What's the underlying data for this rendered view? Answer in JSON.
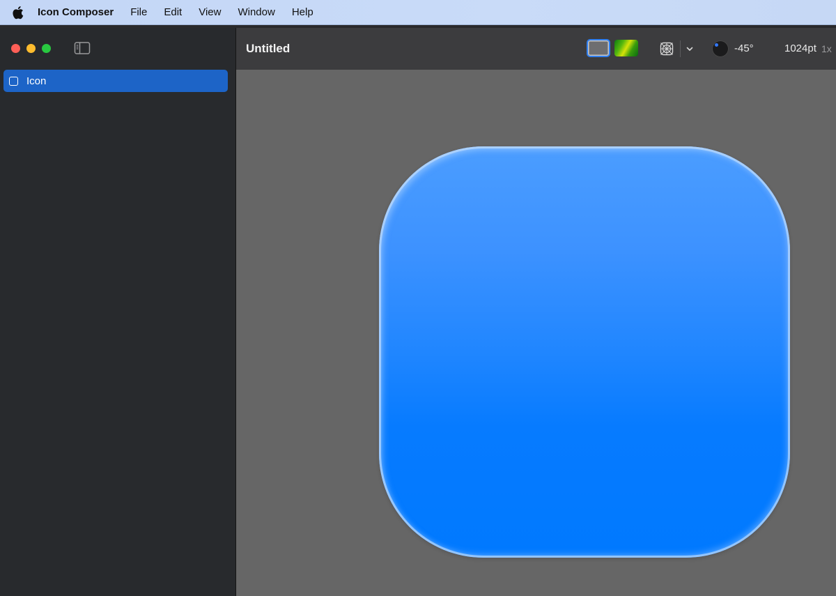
{
  "menubar": {
    "app_name": "Icon Composer",
    "items": [
      "File",
      "Edit",
      "View",
      "Window",
      "Help"
    ]
  },
  "sidebar": {
    "layers": [
      {
        "label": "Icon",
        "selected": true
      }
    ]
  },
  "toolbar": {
    "document_title": "Untitled",
    "light_angle": "-45°",
    "canvas_size": "1024pt",
    "scale": "1x"
  },
  "colors": {
    "accent": "#2f7ff0",
    "selection": "#1d64c7",
    "icon_top": "#4b9dff",
    "icon_bottom": "#0079ff",
    "canvas_bg": "#666666"
  }
}
